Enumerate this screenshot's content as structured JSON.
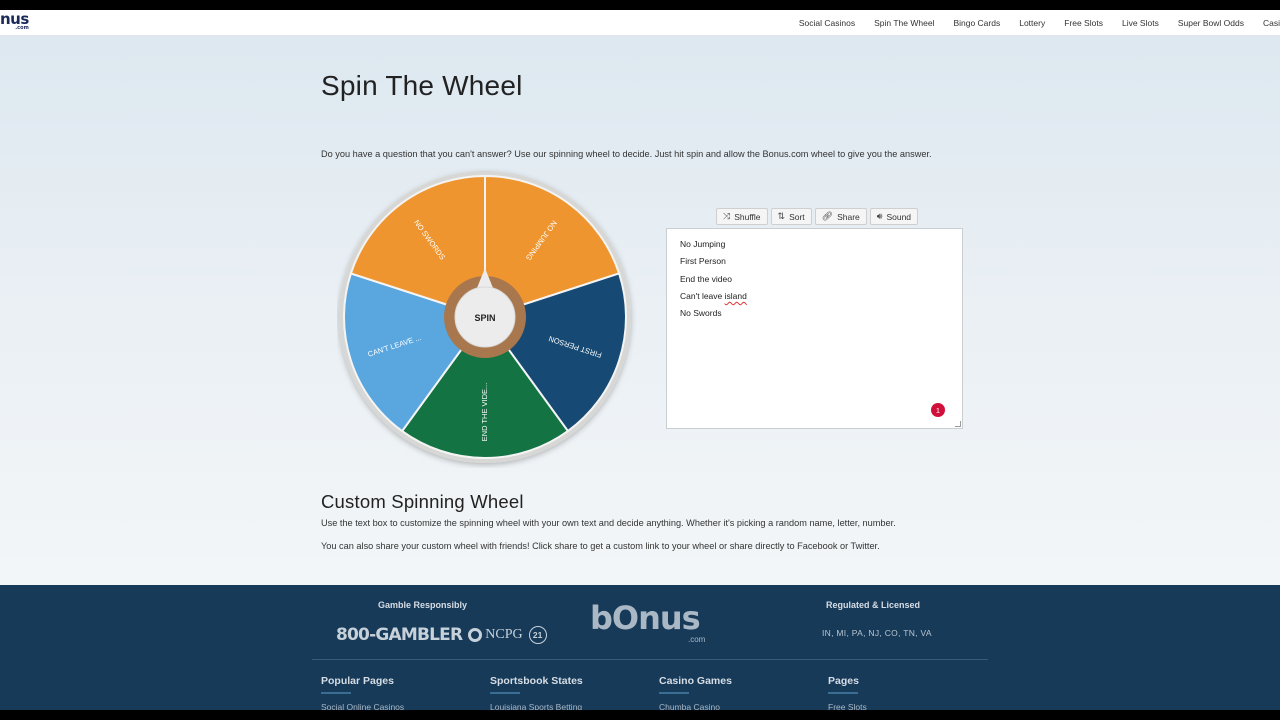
{
  "header": {
    "logo": "nus",
    "logo_sub": ".com",
    "nav": [
      "Social Casinos",
      "Spin The Wheel",
      "Bingo Cards",
      "Lottery",
      "Free Slots",
      "Live Slots",
      "Super Bowl Odds",
      "Casi"
    ]
  },
  "main": {
    "title": "Spin The Wheel",
    "intro": "Do you have a question that you can't answer? Use our spinning wheel to decide. Just hit spin and allow the Bonus.com wheel to give you the answer.",
    "wheel": {
      "spin_label": "SPIN",
      "segments": [
        {
          "label": "NO JUMPING",
          "color": "#ef9530"
        },
        {
          "label": "FIRST PERSON",
          "color": "#164a74"
        },
        {
          "label": "END THE VIDE...",
          "color": "#137343"
        },
        {
          "label": "CAN'T LEAVE ...",
          "color": "#5aa7e0"
        },
        {
          "label": "NO SWORDS",
          "color": "#ef9530"
        }
      ],
      "hub_color": "#a8774d",
      "rim_color": "#d7d8d5"
    },
    "toolbar": {
      "shuffle": "Shuffle",
      "sort": "Sort",
      "share": "Share",
      "sound": "Sound"
    },
    "entries": [
      "No Jumping",
      "First Person",
      "End the video",
      "Can't leave ",
      "No Swords"
    ],
    "entry_misspelled": "island",
    "badge": "1",
    "section_title": "Custom Spinning Wheel",
    "para1": "Use the text box to customize the spinning wheel with your own text and decide anything. Whether it's picking a random name, letter, number.",
    "para2": "You can also share your custom wheel with friends! Click share to get a custom link to your wheel or share directly to Facebook or Twitter."
  },
  "footer": {
    "gamble": "Gamble Responsibly",
    "hotline": "800-GAMBLER",
    "ncpg": "NCPG",
    "age": "21",
    "logo": "bOnus",
    "logo_sub": ".com",
    "regulated": "Regulated & Licensed",
    "states": "IN, MI, PA, NJ, CO, TN, VA",
    "columns": [
      {
        "title": "Popular Pages",
        "link": "Social Online Casinos"
      },
      {
        "title": "Sportsbook States",
        "link": "Louisiana Sports Betting"
      },
      {
        "title": "Casino Games",
        "link": "Chumba Casino"
      },
      {
        "title": "Pages",
        "link": "Free Slots"
      }
    ]
  }
}
